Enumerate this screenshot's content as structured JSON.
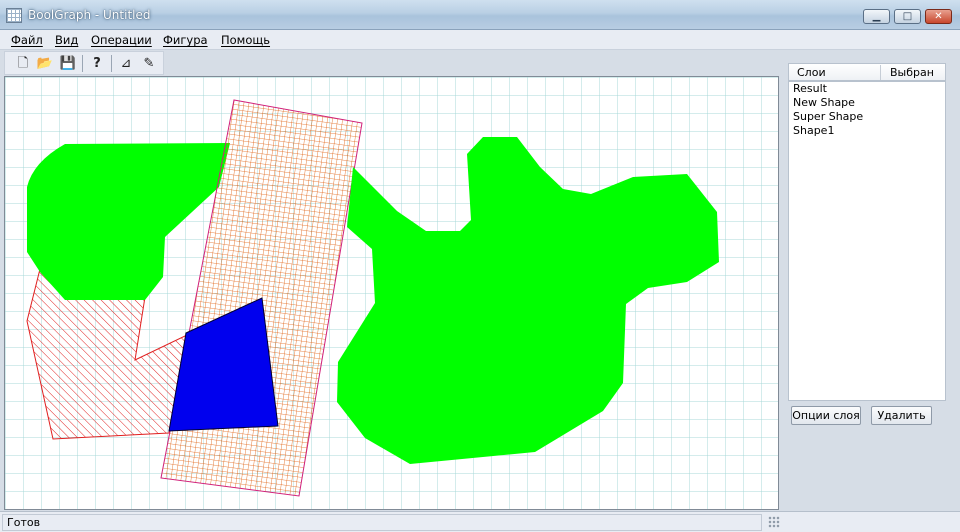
{
  "window": {
    "title": "BoolGraph - Untitled",
    "minimize": "▁",
    "maximize": "□",
    "close": "✕"
  },
  "menu": [
    "Файл",
    "Вид",
    "Операции",
    "Фигура",
    "Помощь"
  ],
  "toolbar": {
    "buttons": [
      {
        "icon": "new-document-icon",
        "glyph": "🗋"
      },
      {
        "icon": "open-folder-icon",
        "glyph": "📂"
      },
      {
        "icon": "save-icon",
        "glyph": "💾"
      },
      {
        "icon": "help-icon",
        "glyph": "?"
      },
      {
        "icon": "polygon-tool-icon",
        "glyph": "⊿"
      },
      {
        "icon": "edit-tool-icon",
        "glyph": "✎"
      }
    ]
  },
  "layers_panel": {
    "col_layers": "Слои",
    "col_selected": "Выбран",
    "layers": [
      "Result",
      "New Shape",
      "Super Shape",
      "Shape1"
    ],
    "options_button": "Опции слоя",
    "delete_button": "Удалить"
  },
  "status": {
    "text": "Готов"
  },
  "colors": {
    "green_shape": "#00ff00",
    "blue_shape": "#0000ee",
    "red_hatch": "#e02020",
    "orange_grid": "#e06010",
    "grid_line": "#a8d8d8"
  }
}
